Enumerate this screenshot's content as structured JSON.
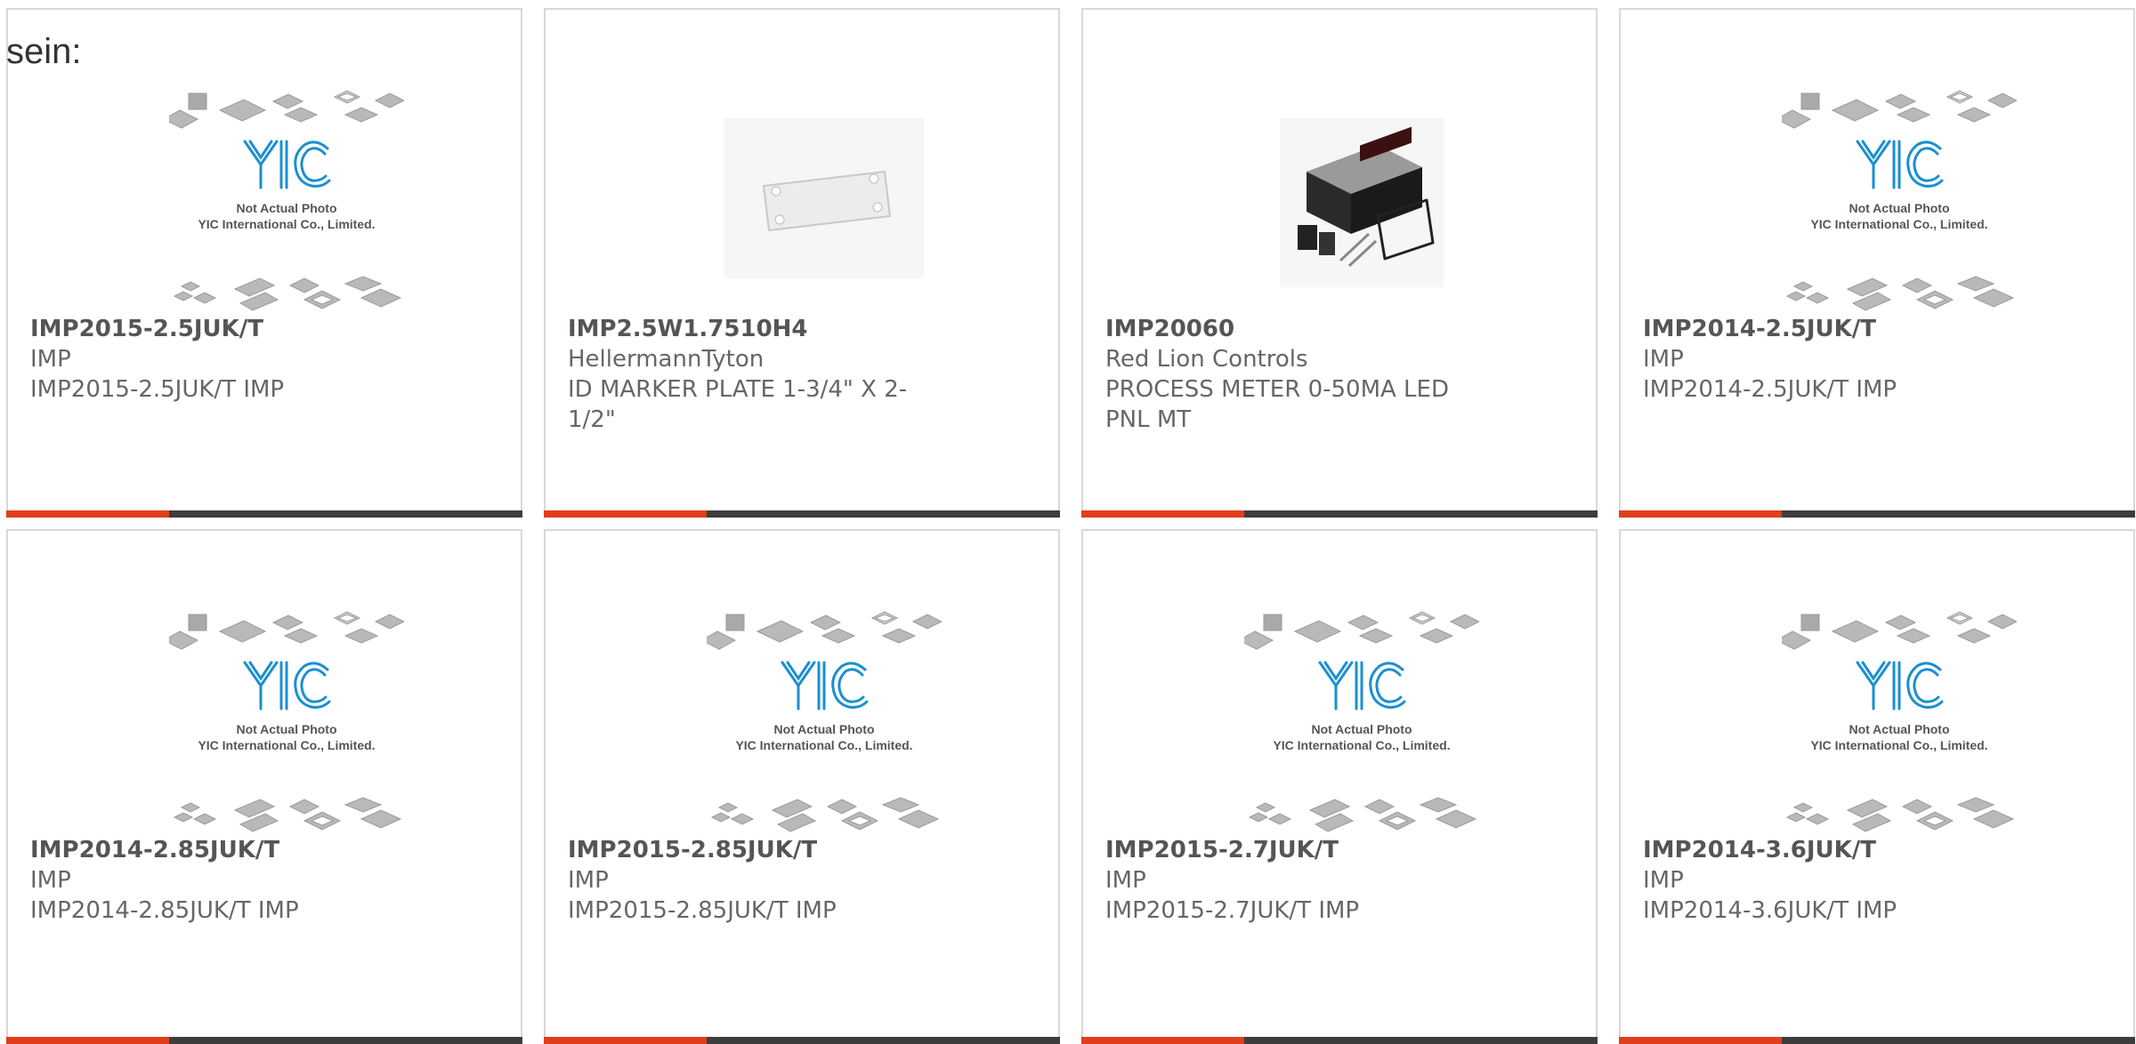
{
  "intro_text": "sein:",
  "placeholder_image": {
    "line1": "Not Actual Photo",
    "line2": "YIC International Co., Limited.",
    "logo": "YIC",
    "logo_color": "#1a8fd0"
  },
  "accent_color": "#e03e1c",
  "products": [
    {
      "part": "IMP2015-2.5JUK/T",
      "maker": "IMP",
      "desc": "IMP2015-2.5JUK/T IMP",
      "image": "placeholder"
    },
    {
      "part": "IMP2.5W1.7510H4",
      "maker": "HellermannTyton",
      "desc": "ID MARKER PLATE 1-3/4\" X 2-1/2\"",
      "image": "marker-plate"
    },
    {
      "part": "IMP20060",
      "maker": "Red Lion Controls",
      "desc": "PROCESS METER 0-50MA LED PNL MT",
      "image": "panel-meter"
    },
    {
      "part": "IMP2014-2.5JUK/T",
      "maker": "IMP",
      "desc": "IMP2014-2.5JUK/T IMP",
      "image": "placeholder"
    },
    {
      "part": "IMP2014-2.85JUK/T",
      "maker": "IMP",
      "desc": "IMP2014-2.85JUK/T IMP",
      "image": "placeholder"
    },
    {
      "part": "IMP2015-2.85JUK/T",
      "maker": "IMP",
      "desc": "IMP2015-2.85JUK/T IMP",
      "image": "placeholder"
    },
    {
      "part": "IMP2015-2.7JUK/T",
      "maker": "IMP",
      "desc": "IMP2015-2.7JUK/T IMP",
      "image": "placeholder"
    },
    {
      "part": "IMP2014-3.6JUK/T",
      "maker": "IMP",
      "desc": "IMP2014-3.6JUK/T IMP",
      "image": "placeholder"
    }
  ]
}
